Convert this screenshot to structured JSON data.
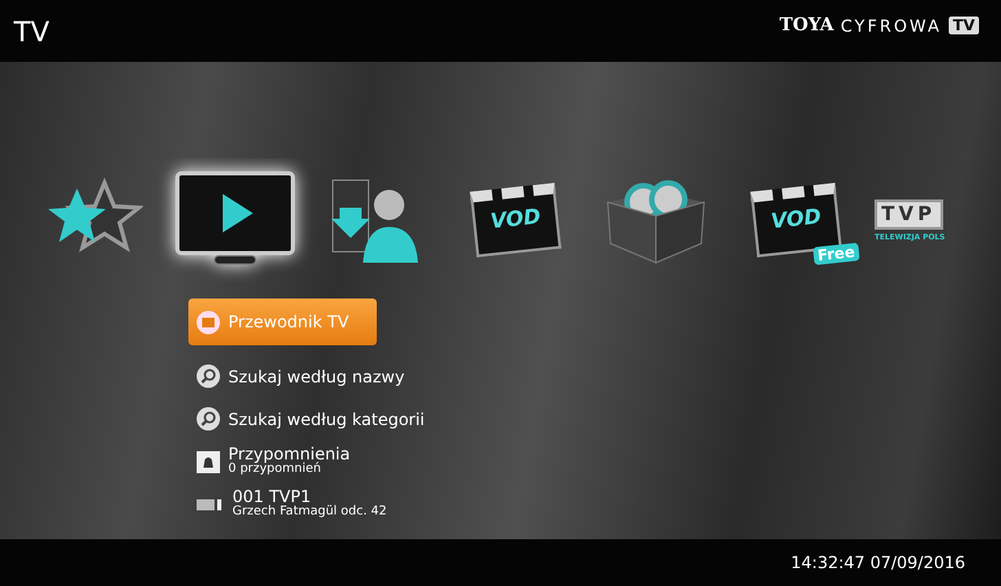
{
  "header": {
    "title": "TV",
    "logo": {
      "brand": "TOYA",
      "word": "CYFROWA",
      "badge": "TV"
    }
  },
  "carousel": [
    {
      "kind": "favorites",
      "selected": false
    },
    {
      "kind": "tv",
      "selected": true
    },
    {
      "kind": "recordings",
      "selected": false
    },
    {
      "kind": "vod",
      "selected": false,
      "label": "VOD"
    },
    {
      "kind": "packages",
      "selected": false
    },
    {
      "kind": "vod-free",
      "selected": false,
      "label": "VOD",
      "tag": "Free"
    },
    {
      "kind": "channel-logo",
      "selected": false,
      "label": "TVP",
      "caption": "TELEWIZJA POLS"
    }
  ],
  "menu": [
    {
      "kind": "guide",
      "label": "Przewodnik TV",
      "selected": true
    },
    {
      "kind": "search",
      "label": "Szukaj według nazwy",
      "selected": false
    },
    {
      "kind": "search",
      "label": "Szukaj według kategorii",
      "selected": false
    },
    {
      "kind": "reminders",
      "label": "Przypomnienia",
      "sub": "0 przypomnień",
      "selected": false
    },
    {
      "kind": "channel",
      "label": "001 TVP1",
      "sub": "Grzech Fatmagül odc. 42",
      "selected": false
    }
  ],
  "status_bar": {
    "datetime": "14:32:47 07/09/2016"
  }
}
